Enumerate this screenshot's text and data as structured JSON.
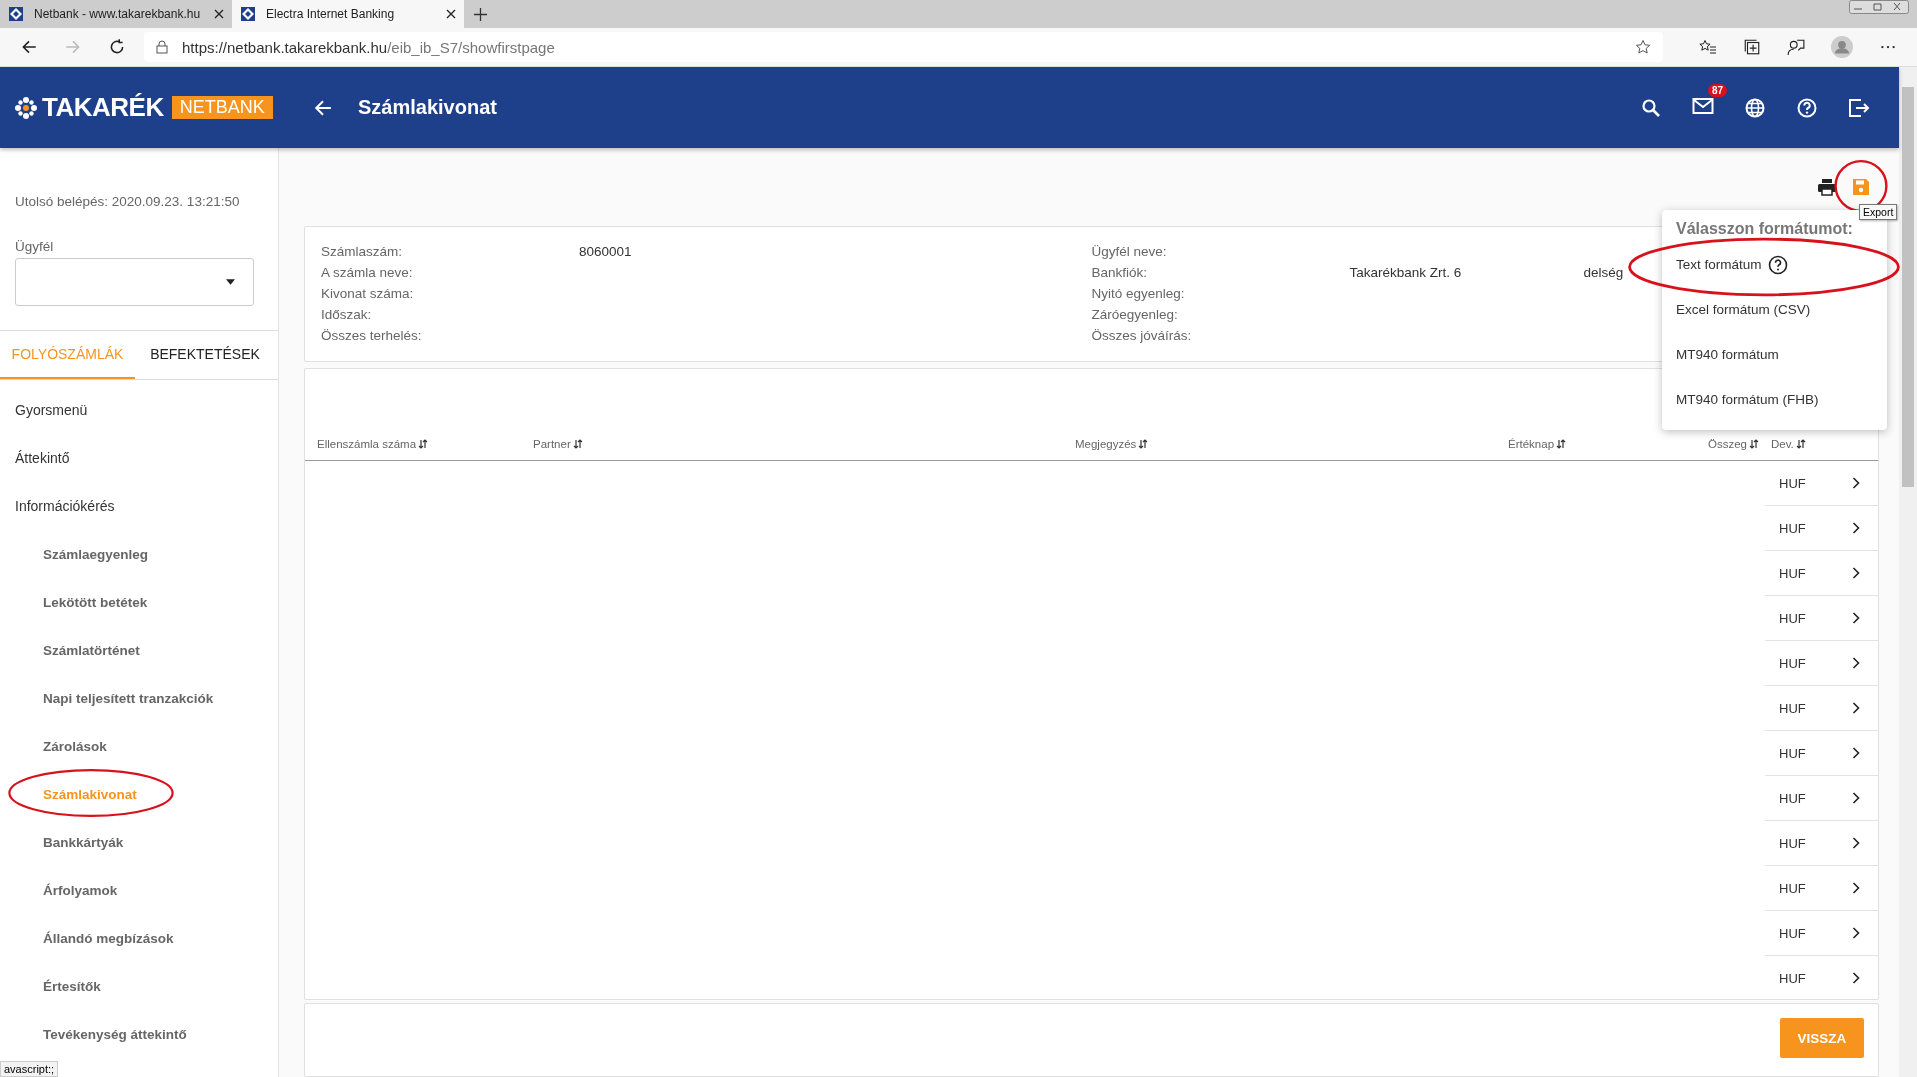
{
  "browser": {
    "tabs": [
      {
        "title": "Netbank - www.takarekbank.hu",
        "selected": false
      },
      {
        "title": "Electra Internet Banking",
        "selected": true
      }
    ],
    "url": {
      "host": "https://netbank.takarekbank.hu",
      "path": "/eib_ib_S7/showfirstpage"
    },
    "status_text": "avascript:;"
  },
  "header": {
    "logo": "TAKARÉK",
    "logo_badge": "NETBANK",
    "title": "Számlakivonat",
    "mail_count": "87"
  },
  "sidebar": {
    "last_login": "Utolsó belépés: 2020.09.23. 13:21:50",
    "client_label": "Ügyfél",
    "tabs": [
      {
        "label": "FOLYÓSZÁMLÁK",
        "selected": true
      },
      {
        "label": "BEFEKTETÉSEK",
        "selected": false
      }
    ],
    "menu": [
      {
        "label": "Gyorsmenü",
        "selected": false,
        "circled": false
      },
      {
        "label": "Áttekintő",
        "selected": false,
        "circled": false
      },
      {
        "label": "Információkérés",
        "selected": false,
        "circled": false,
        "children": [
          {
            "label": "Számlaegyenleg",
            "selected": false,
            "circled": false
          },
          {
            "label": "Lekötött betétek",
            "selected": false,
            "circled": false
          },
          {
            "label": "Számlatörténet",
            "selected": false,
            "circled": false
          },
          {
            "label": "Napi teljesített tranzakciók",
            "selected": false,
            "circled": false
          },
          {
            "label": "Zárolások",
            "selected": false,
            "circled": false
          },
          {
            "label": "Számlakivonat",
            "selected": true,
            "circled": true
          },
          {
            "label": "Bankkártyák",
            "selected": false,
            "circled": false
          },
          {
            "label": "Árfolyamok",
            "selected": false,
            "circled": false
          },
          {
            "label": "Állandó megbízások",
            "selected": false,
            "circled": false
          },
          {
            "label": "Értesítők",
            "selected": false,
            "circled": false
          },
          {
            "label": "Tevékenység áttekintő",
            "selected": false,
            "circled": false
          }
        ]
      }
    ]
  },
  "toolbar": {
    "export_circled": true,
    "export_tooltip": "Export"
  },
  "info": {
    "left": [
      {
        "label": "Számlaszám:",
        "value": "8060001"
      },
      {
        "label": "A számla neve:"
      },
      {
        "label": "Kivonat száma:"
      },
      {
        "label": "Időszak:"
      },
      {
        "label": "Összes terhelés:"
      }
    ],
    "right": [
      {
        "label": "Ügyfél neve:"
      },
      {
        "label": "Bankfiók:",
        "value": "Takarékbank Zrt. 6",
        "extra": "delség"
      },
      {
        "label": "Nyitó egyenleg:"
      },
      {
        "label": "Záróegyenleg:"
      },
      {
        "label": "Összes jóváírás:"
      }
    ]
  },
  "export_menu": {
    "title": "Válasszon formátumot:",
    "options": [
      {
        "label": "Text formátum",
        "help": true,
        "circled": true
      },
      {
        "label": "Excel formátum (CSV)",
        "help": false,
        "circled": false
      },
      {
        "label": "MT940 formátum",
        "help": false,
        "circled": false
      },
      {
        "label": "MT940 formátum (FHB)",
        "help": false,
        "circled": false
      }
    ]
  },
  "table": {
    "columns": [
      "Ellenszámla száma",
      "Partner",
      "Megjegyzés",
      "Értéknap",
      "Összeg",
      "Dev."
    ],
    "rows": [
      {
        "currency": "HUF"
      },
      {
        "currency": "HUF"
      },
      {
        "currency": "HUF"
      },
      {
        "currency": "HUF"
      },
      {
        "currency": "HUF"
      },
      {
        "currency": "HUF"
      },
      {
        "currency": "HUF"
      },
      {
        "currency": "HUF"
      },
      {
        "currency": "HUF"
      },
      {
        "currency": "HUF"
      },
      {
        "currency": "HUF"
      },
      {
        "currency": "HUF"
      }
    ]
  },
  "back_button": "VISSZA"
}
